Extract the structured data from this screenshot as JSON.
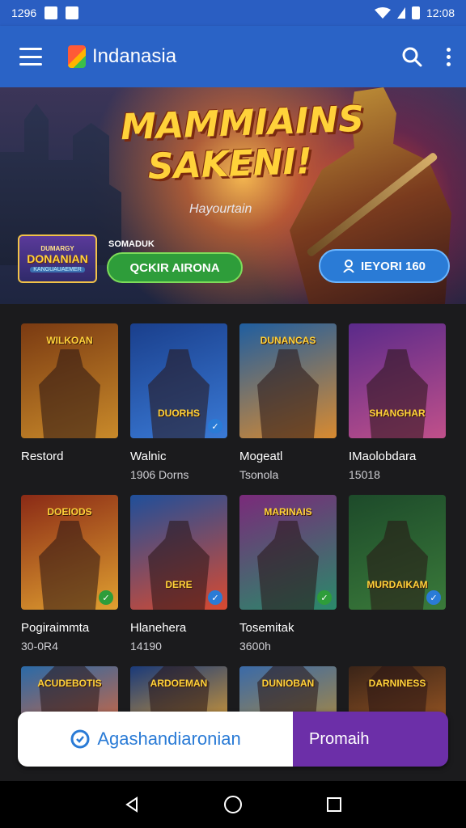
{
  "status_bar": {
    "time_left": "1296",
    "time_right": "12:08"
  },
  "app_bar": {
    "title": "Indanasia"
  },
  "hero": {
    "title_line1": "MAMMIAINS",
    "title_line2": "SAKENI!",
    "subtitle": "Hayourtain",
    "badge_top": "DUMARGY",
    "badge_main": "DONANIAN",
    "badge_bottom": "KANGUAUAEMER",
    "small_label": "SOMADUK",
    "green_button": "QCKIR AIRONA",
    "blue_button": "IEYORI 160"
  },
  "games": [
    {
      "thumb_label": "WILKOAN",
      "name": "Restord",
      "sub": "",
      "colors": [
        "#7a3a12",
        "#c98a2a"
      ],
      "badge": ""
    },
    {
      "thumb_label": "DUORHS",
      "name": "Walnic",
      "sub": "1906 Dorns",
      "colors": [
        "#1a3f8c",
        "#3a7ad6"
      ],
      "badge": "check"
    },
    {
      "thumb_label": "DUNANCAS",
      "name": "Mogeatl",
      "sub": "Tsonola",
      "colors": [
        "#1f5ea0",
        "#d88a30"
      ],
      "badge": ""
    },
    {
      "thumb_label": "SHANGHAR",
      "name": "IMaolobdara",
      "sub": "15018",
      "colors": [
        "#5a2a8a",
        "#c0508a"
      ],
      "badge": ""
    },
    {
      "thumb_label": "DOEIODS",
      "name": "Pogiraimmta",
      "sub": "30-0R4",
      "colors": [
        "#8a2a16",
        "#e0a030"
      ],
      "badge": "check"
    },
    {
      "thumb_label": "DERE",
      "name": "Hlanehera",
      "sub": "14190",
      "colors": [
        "#1f4f9a",
        "#d84a30"
      ],
      "badge": "check"
    },
    {
      "thumb_label": "MARINAIS",
      "name": "Tosemitak",
      "sub": "3600h",
      "colors": [
        "#7a2a7a",
        "#2a8a6a"
      ],
      "badge": "check"
    },
    {
      "thumb_label": "MURDAIKAM",
      "name": "",
      "sub": "",
      "colors": [
        "#1d4a2a",
        "#3a7a3a"
      ],
      "badge": "check"
    },
    {
      "thumb_label": "ACUDEBOTIS",
      "name": "",
      "sub": "",
      "colors": [
        "#2a6aa8",
        "#d8663a"
      ],
      "badge": ""
    },
    {
      "thumb_label": "ARDOEMAN",
      "name": "",
      "sub": "",
      "colors": [
        "#1a3a7a",
        "#e0a030"
      ],
      "badge": ""
    },
    {
      "thumb_label": "DUNIOBAN",
      "name": "",
      "sub": "",
      "colors": [
        "#3a6aa8",
        "#b08a3a"
      ],
      "badge": ""
    },
    {
      "thumb_label": "DARNINESS",
      "name": "",
      "sub": "",
      "colors": [
        "#3a2418",
        "#a05a24"
      ],
      "badge": ""
    }
  ],
  "bottom_banner": {
    "left_text": "Agashandiaronian",
    "right_text": "Promaih"
  }
}
